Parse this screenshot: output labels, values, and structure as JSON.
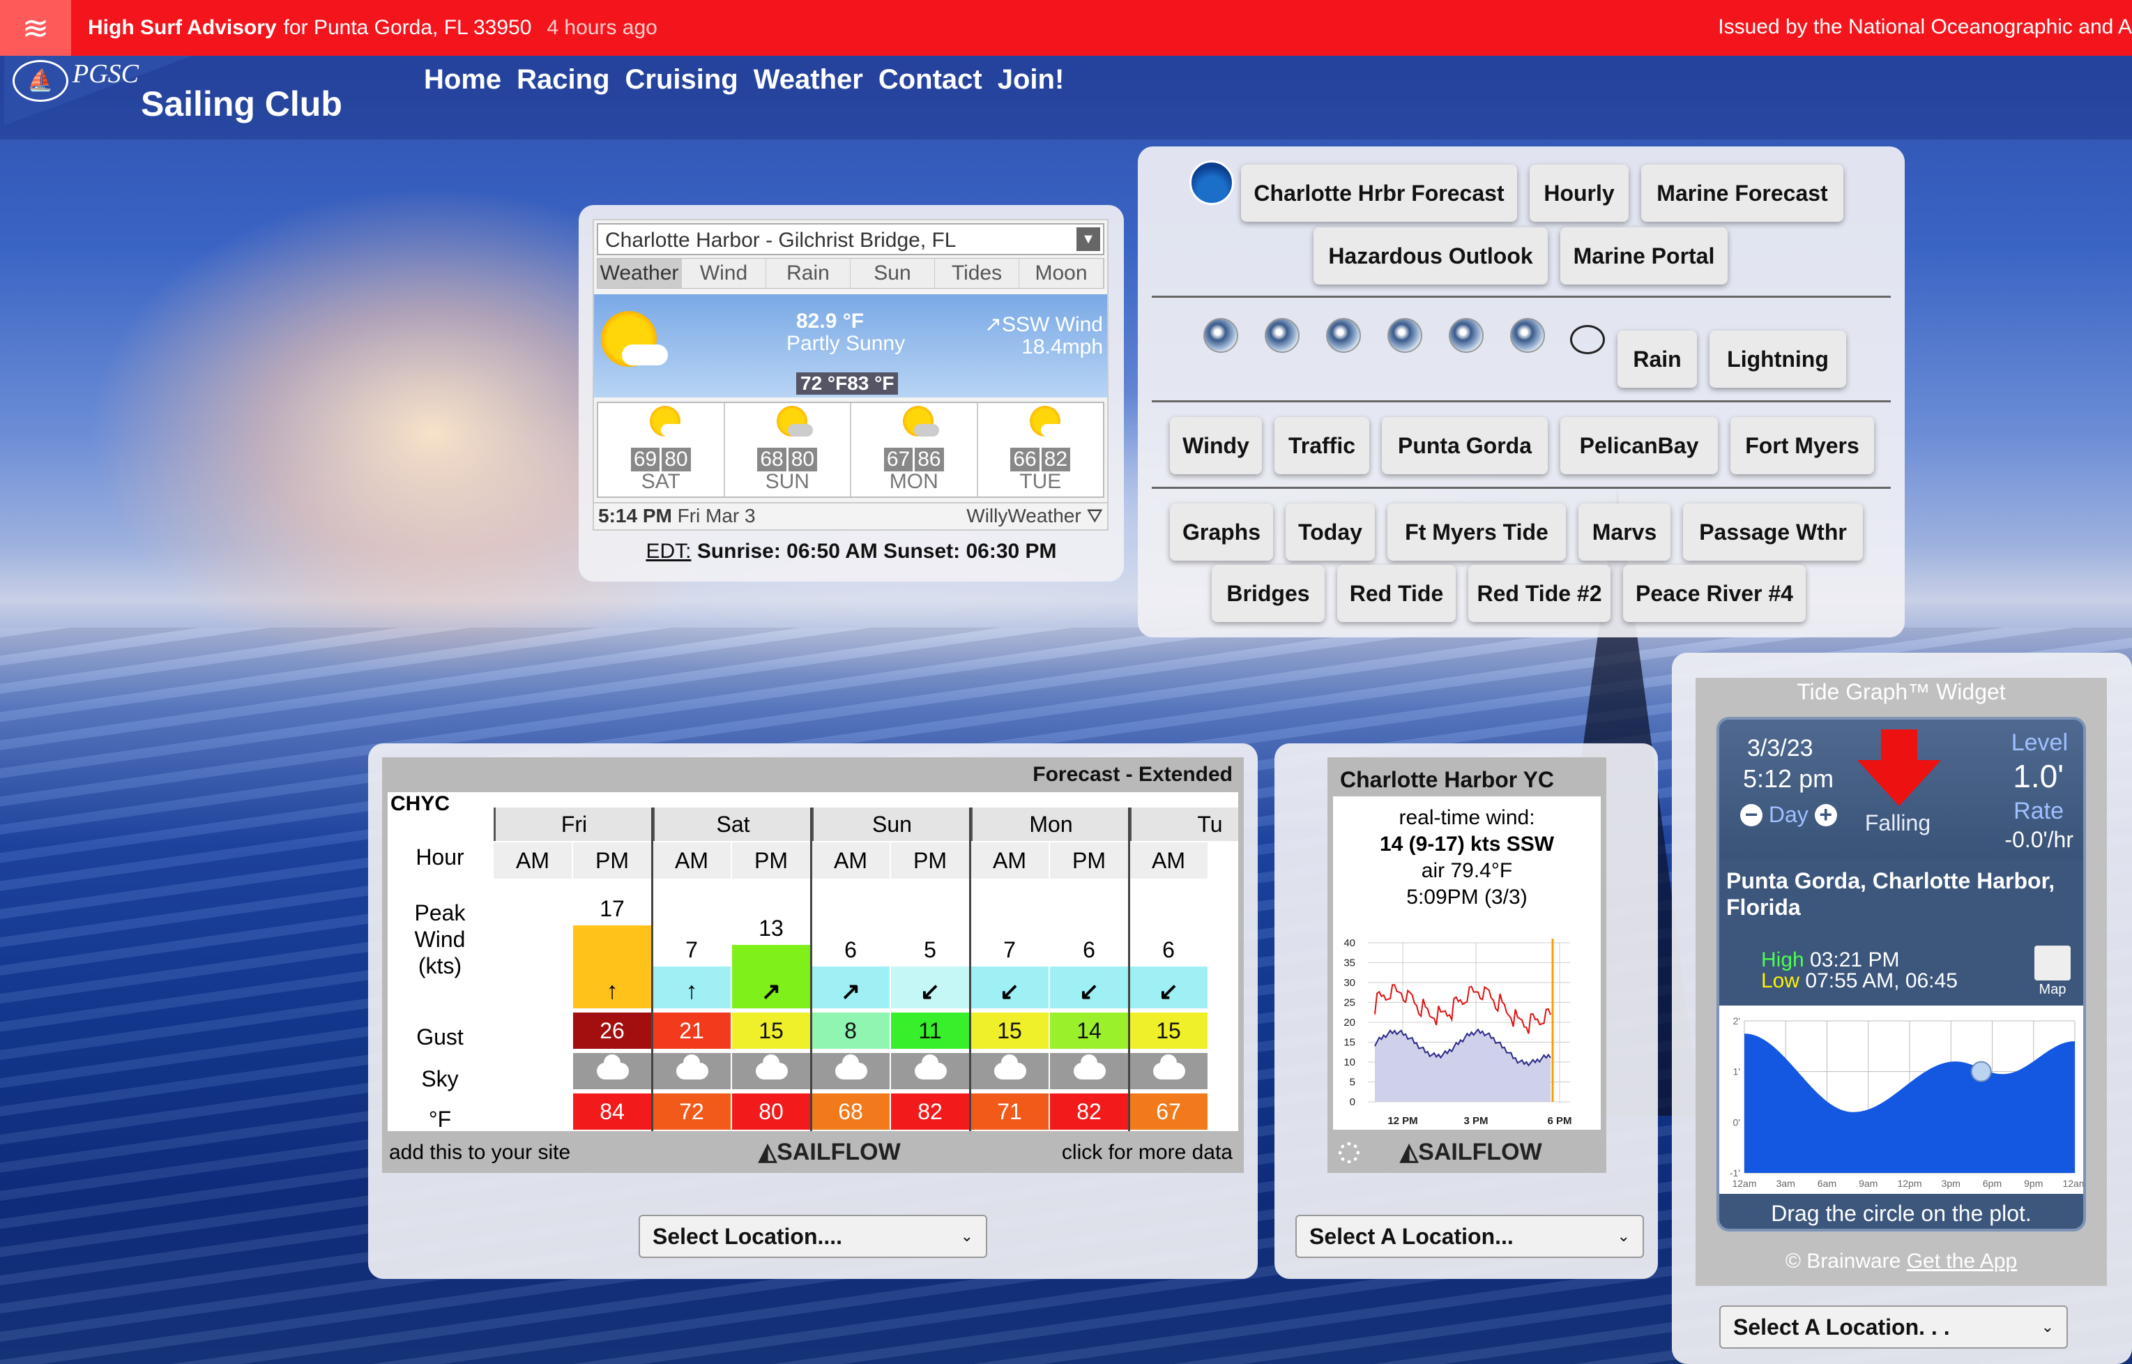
{
  "alert": {
    "title": "High Surf Advisory",
    "location": "for Punta Gorda, FL 33950",
    "time": "4 hours ago",
    "issued": "Issued by the National Oceanographic and A"
  },
  "header": {
    "logo_text": "PGSC",
    "club_name": "Sailing Club",
    "nav": [
      "Home",
      "Racing",
      "Cruising",
      "Weather",
      "Contact",
      "Join!"
    ]
  },
  "weather_widget": {
    "location": "Charlotte Harbor - Gilchrist Bridge, FL",
    "tabs": [
      "Weather",
      "Wind",
      "Rain",
      "Sun",
      "Tides",
      "Moon"
    ],
    "active_tab": "Weather",
    "temp": "82.9 °F",
    "condition": "Partly Sunny",
    "wind_dir": "SSW Wind",
    "wind_speed": "18.4mph",
    "low_high": "72 °F83 °F",
    "days": [
      {
        "lo": "69",
        "hi": "80",
        "name": "SAT"
      },
      {
        "lo": "68",
        "hi": "80",
        "name": "SUN"
      },
      {
        "lo": "67",
        "hi": "86",
        "name": "MON"
      },
      {
        "lo": "66",
        "hi": "82",
        "name": "TUE"
      }
    ],
    "time": "5:14 PM",
    "date": "Fri Mar 3",
    "brand": "WillyWeather",
    "tz": "EDT:",
    "sun_times": "Sunrise: 06:50 AM Sunset: 06:30 PM"
  },
  "links": {
    "row1": [
      "Charlotte Hrbr Forecast",
      "Hourly",
      "Marine Forecast"
    ],
    "row2": [
      "Hazardous Outlook",
      "Marine Portal"
    ],
    "row3": [
      "Rain",
      "Lightning"
    ],
    "row4": [
      "Windy",
      "Traffic",
      "Punta Gorda",
      "PelicanBay",
      "Fort Myers"
    ],
    "row5": [
      "Graphs",
      "Today",
      "Ft Myers Tide",
      "Marvs",
      "Passage Wthr"
    ],
    "row6": [
      "Bridges",
      "Red Tide",
      "Red Tide #2",
      "Peace River #4"
    ]
  },
  "sailflow_extended": {
    "title": "Forecast - Extended",
    "station": "CHYC",
    "days": [
      "Fri",
      "Sat",
      "Sun",
      "Mon",
      "Tu"
    ],
    "periods": [
      "AM",
      "PM",
      "AM",
      "PM",
      "AM",
      "PM",
      "AM",
      "PM",
      "AM"
    ],
    "row_labels": {
      "hour": "Hour",
      "peak_wind": "Peak Wind (kts)",
      "gust": "Gust",
      "sky": "Sky",
      "temp": "°F"
    },
    "peak_wind": [
      "",
      "17",
      "7",
      "13",
      "6",
      "5",
      "7",
      "6",
      "6"
    ],
    "wind_arrows": [
      "",
      "↑",
      "↑",
      "↗",
      "↗",
      "↙",
      "↙",
      "↙",
      "↙"
    ],
    "gust": [
      "",
      "26",
      "21",
      "15",
      "8",
      "11",
      "15",
      "14",
      "15"
    ],
    "temp": [
      "",
      "84",
      "72",
      "80",
      "68",
      "82",
      "71",
      "82",
      "67"
    ],
    "footer_left": "add this to your site",
    "brand": "SAILFLOW",
    "footer_right": "click for more data",
    "select": "Select Location...."
  },
  "sailflow_realtime": {
    "title": "Charlotte Harbor YC",
    "label": "real-time wind:",
    "wind": "14 (9-17) kts SSW",
    "air": "air 79.4°F",
    "time": "5:09PM (3/3)",
    "y_ticks": [
      "40",
      "35",
      "30",
      "25",
      "20",
      "15",
      "10",
      "5",
      "0"
    ],
    "x_ticks": [
      "12 PM",
      "3 PM",
      "6 PM"
    ],
    "brand": "SAILFLOW",
    "select": "Select A Location..."
  },
  "tide": {
    "title": "Tide Graph™ Widget",
    "date": "3/3/23",
    "time": "5:12 pm",
    "day_label": "Day",
    "trend": "Falling",
    "level_label": "Level",
    "level": "1.0'",
    "rate_label": "Rate",
    "rate": "-0.0'/hr",
    "place": "Punta Gorda, Charlotte Harbor, Florida",
    "high_label": "High",
    "high": "03:21 PM",
    "low_label": "Low",
    "low": "07:55 AM, 06:45",
    "map_label": "Map",
    "y_ticks": [
      "2'",
      "1'",
      "0'",
      "-1'"
    ],
    "x_ticks": [
      "12am",
      "3am",
      "6am",
      "9am",
      "12pm",
      "3pm",
      "6pm",
      "9pm",
      "12am"
    ],
    "drag_hint": "Drag the circle on the plot.",
    "copyright": "© Brainware",
    "app_link": "Get the App",
    "select": "Select A Location. . ."
  },
  "colors": {
    "alert_red": "#f4151c",
    "gust_colors": [
      "#a30f0f",
      "#f23b1c",
      "#f0f02a",
      "#8ff5b0",
      "#37f02b",
      "#f0f02a",
      "#9af02b",
      "#f0f02a"
    ],
    "temp_colors": [
      "#f21a1a",
      "#f25a1a",
      "#f21a1a",
      "#f27a1a",
      "#f21a1a",
      "#f25a1a",
      "#f21a1a",
      "#f27a1a"
    ],
    "wind_colors": [
      "#ffc21a",
      "#9ef0f5",
      "#7ff01a",
      "#9ef0f5",
      "#c6f7f7",
      "#9ef0f5",
      "#9ef0f5",
      "#9ef0f5"
    ]
  }
}
